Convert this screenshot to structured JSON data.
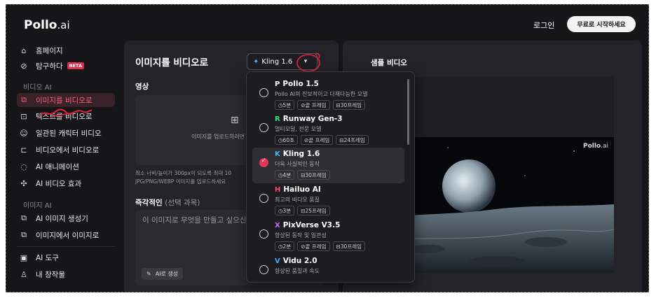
{
  "header": {
    "logo_main": "Pollo",
    "logo_suffix": ".ai",
    "login": "로그인",
    "start_free": "무료로 시작하세요"
  },
  "sidebar": {
    "home": "홈페이지",
    "explore": "탐구하다",
    "beta_badge": "BETA",
    "video_ai_section": "비디오 AI",
    "image_to_video": "이미지를 비디오로",
    "text_to_video": "텍스트를 비디오로",
    "consistent_character": "일관된 캐릭터 비디오",
    "video_to_video": "비디오에서 비디오로",
    "ai_animation": "AI 애니메이션",
    "ai_video_effects": "AI 비디오 효과",
    "image_ai_section": "이미지 AI",
    "ai_image_gen": "AI 이미지 생성기",
    "image_to_image": "이미지에서 이미지로",
    "ai_tools": "AI 도구",
    "my_creations": "내 창작물"
  },
  "main": {
    "title": "이미지를 비디오로",
    "selected_model": "Kling 1.6",
    "video_label": "영상",
    "upload_text": "이미지를 업로드하려면 클릭",
    "hint_line1": "최소 너비/높이가 300px이 되도록 최대 10",
    "hint_line2": "JPG/PNG/WEBP 이미지를 업로드하세요",
    "prompt_label": "즉각적인",
    "prompt_optional": "(선택 과목)",
    "prompt_placeholder": "이 이미지로 무엇을 만들고 싶으신가요?",
    "ai_generate": "AI로 생성"
  },
  "preview": {
    "title": "샘플 비디오",
    "watermark_main": "Pollo",
    "watermark_suffix": ".ai"
  },
  "models": [
    {
      "name": "Pollo 1.5",
      "icon": "P",
      "icon_color": "#ffffff",
      "desc": "Pollo AI의 진보적이고 다재다능한 모델",
      "tags": [
        "◷5분",
        "⊘끝 프레임",
        "⊟30프레임"
      ],
      "selected": false
    },
    {
      "name": "Runway Gen-3",
      "icon": "R",
      "icon_color": "#3ddc84",
      "desc": "멀티모달, 전문 모델",
      "tags": [
        "◷60초",
        "⊘끝 프레임",
        "⊟24프레임"
      ],
      "selected": false
    },
    {
      "name": "Kling 1.6",
      "icon": "K",
      "icon_color": "#3fb6ff",
      "desc": "더욱 사실적인 동작",
      "tags": [
        "◷4분",
        "⊟30프레임"
      ],
      "selected": true
    },
    {
      "name": "Hailuo AI",
      "icon": "H",
      "icon_color": "#ff4d6a",
      "desc": "최고의 비디오 품질",
      "tags": [
        "◷3분",
        "⊟25프레임"
      ],
      "selected": false
    },
    {
      "name": "PixVerse V3.5",
      "icon": "X",
      "icon_color": "#c86cff",
      "desc": "향상된 동작 및 일관성",
      "tags": [
        "◷2분",
        "⊘끝 프레임",
        "⊟30프레임"
      ],
      "selected": false
    },
    {
      "name": "Vidu 2.0",
      "icon": "V",
      "icon_color": "#4aa8ff",
      "desc": "향상된 품질과 속도",
      "tags": [],
      "selected": false
    }
  ],
  "colors": {
    "accent": "#e8355a",
    "background": "#161619",
    "panel": "#232329"
  }
}
